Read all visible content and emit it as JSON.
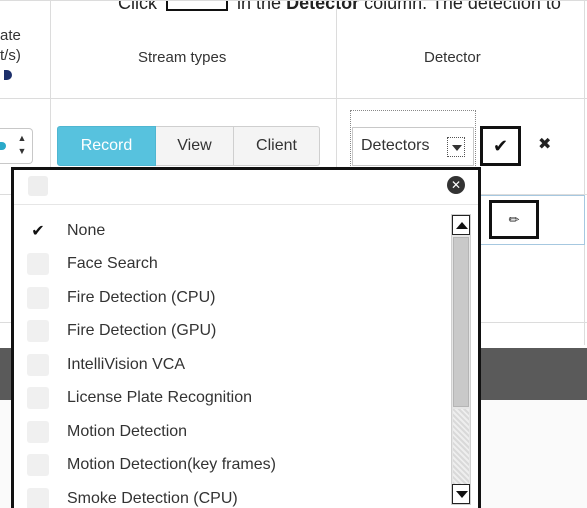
{
  "instruction": {
    "prefix": "Click",
    "suffix_before": "in the",
    "column_name": "Detector",
    "suffix_after": "column. The detection to"
  },
  "table": {
    "headers": {
      "rate_line1": "ate",
      "rate_line2": "t/s)",
      "stream_types": "Stream types",
      "detector": "Detector"
    }
  },
  "stream_types": {
    "options": [
      "Record",
      "View",
      "Client"
    ],
    "selected": "Record"
  },
  "detector_select": {
    "value": "Detectors"
  },
  "dropdown": {
    "items": [
      {
        "label": "None",
        "checked": true
      },
      {
        "label": "Face Search",
        "checked": false
      },
      {
        "label": "Fire Detection (CPU)",
        "checked": false
      },
      {
        "label": "Fire Detection (GPU)",
        "checked": false
      },
      {
        "label": "IntelliVision VCA",
        "checked": false
      },
      {
        "label": "License Plate Recognition",
        "checked": false
      },
      {
        "label": "Motion Detection",
        "checked": false
      },
      {
        "label": "Motion Detection(key frames)",
        "checked": false
      },
      {
        "label": "Smoke Detection (CPU)",
        "checked": false
      }
    ]
  },
  "colors": {
    "accent": "#57c2de",
    "highlight_border": "#111111",
    "dark_band": "#5a5a5a"
  }
}
